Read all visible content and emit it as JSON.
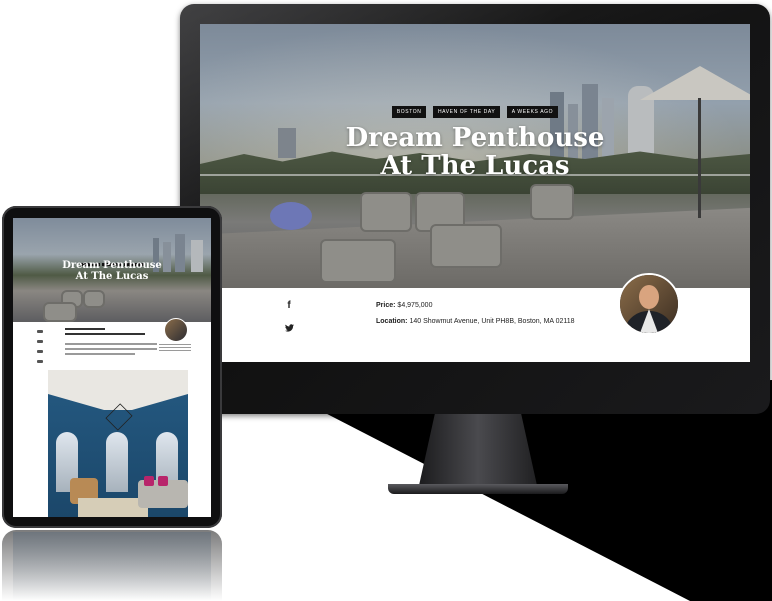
{
  "listing": {
    "tags": [
      "BOSTON",
      "HAVEN OF THE DAY",
      "A WEEKS AGO"
    ],
    "title_line1": "Dream Penthouse",
    "title_line2": "At The Lucas",
    "price_label": "Price:",
    "price_value": "$4,975,000",
    "location_label": "Location:",
    "location_value": "140 Showmut Avenue, Unit PH8B, Boston, MA 02118"
  },
  "share": {
    "facebook_glyph": "f",
    "twitter_glyph": "🐦"
  },
  "icons": {
    "facebook": "facebook-icon",
    "twitter": "twitter-icon"
  },
  "colors": {
    "tag_bg": "#111111",
    "title": "#ffffff",
    "page_bg": "#ffffff"
  }
}
